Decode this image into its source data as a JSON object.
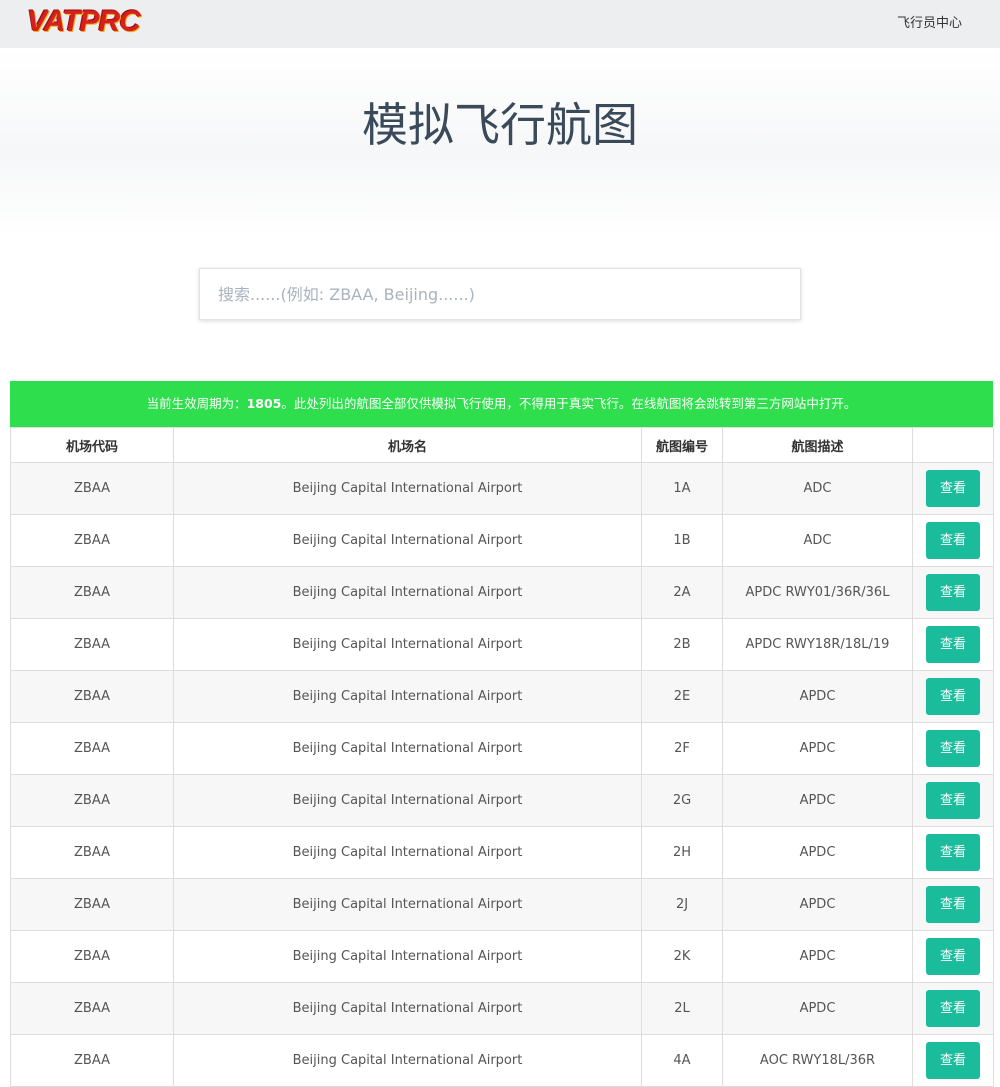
{
  "navbar": {
    "brand": "VATPRC",
    "pilot_center": "飞行员中心"
  },
  "hero": {
    "title": "模拟飞行航图"
  },
  "search": {
    "placeholder": "搜索......(例如: ZBAA, Beijing......)",
    "value": ""
  },
  "notice": {
    "prefix": "当前生效周期为：",
    "cycle": "1805",
    "suffix": "。此处列出的航图全部仅供模拟飞行使用，不得用于真实飞行。在线航图将会跳转到第三方网站中打开。"
  },
  "table": {
    "headers": [
      "机场代码",
      "机场名",
      "航图编号",
      "航图描述",
      ""
    ],
    "view_label": "查看",
    "rows": [
      {
        "icao": "ZBAA",
        "name": "Beijing Capital International Airport",
        "chart_no": "1A",
        "desc": "ADC"
      },
      {
        "icao": "ZBAA",
        "name": "Beijing Capital International Airport",
        "chart_no": "1B",
        "desc": "ADC"
      },
      {
        "icao": "ZBAA",
        "name": "Beijing Capital International Airport",
        "chart_no": "2A",
        "desc": "APDC RWY01/36R/36L"
      },
      {
        "icao": "ZBAA",
        "name": "Beijing Capital International Airport",
        "chart_no": "2B",
        "desc": "APDC RWY18R/18L/19"
      },
      {
        "icao": "ZBAA",
        "name": "Beijing Capital International Airport",
        "chart_no": "2E",
        "desc": "APDC"
      },
      {
        "icao": "ZBAA",
        "name": "Beijing Capital International Airport",
        "chart_no": "2F",
        "desc": "APDC"
      },
      {
        "icao": "ZBAA",
        "name": "Beijing Capital International Airport",
        "chart_no": "2G",
        "desc": "APDC"
      },
      {
        "icao": "ZBAA",
        "name": "Beijing Capital International Airport",
        "chart_no": "2H",
        "desc": "APDC"
      },
      {
        "icao": "ZBAA",
        "name": "Beijing Capital International Airport",
        "chart_no": "2J",
        "desc": "APDC"
      },
      {
        "icao": "ZBAA",
        "name": "Beijing Capital International Airport",
        "chart_no": "2K",
        "desc": "APDC"
      },
      {
        "icao": "ZBAA",
        "name": "Beijing Capital International Airport",
        "chart_no": "2L",
        "desc": "APDC"
      },
      {
        "icao": "ZBAA",
        "name": "Beijing Capital International Airport",
        "chart_no": "4A",
        "desc": "AOC RWY18L/36R"
      }
    ]
  },
  "colors": {
    "notice_bg": "#2ede4d",
    "button_bg": "#1abc9c",
    "brand_red": "#d61f1f"
  }
}
